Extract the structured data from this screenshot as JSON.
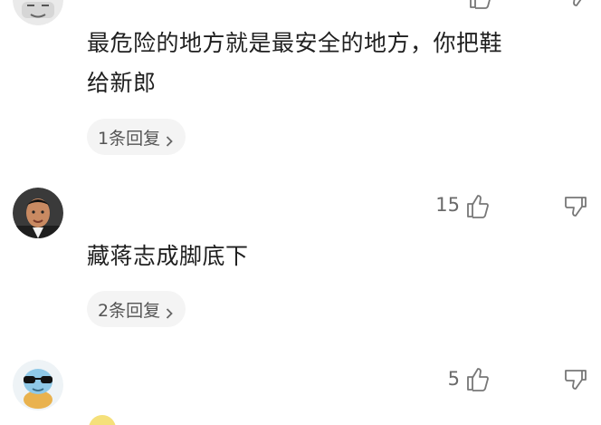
{
  "comments": [
    {
      "text_line1": "最危险的地方就是最安全的地方，你把鞋",
      "text_line2": "给新郎",
      "reply_label": "1条回复",
      "avatar_icon": "meme-face-avatar"
    },
    {
      "likes": "15",
      "text": "藏蒋志成脚底下",
      "reply_label": "2条回复",
      "avatar_icon": "man-portrait-avatar"
    },
    {
      "likes": "5",
      "avatar_icon": "squirtle-sunglasses-avatar"
    }
  ],
  "icons": {
    "like": "thumbs-up-icon",
    "dislike": "thumbs-down-icon",
    "chevron": "chevron-right-icon"
  },
  "colors": {
    "text": "#1f1f1f",
    "secondary": "#6a6a6a",
    "pill_bg": "#f4f4f4"
  }
}
